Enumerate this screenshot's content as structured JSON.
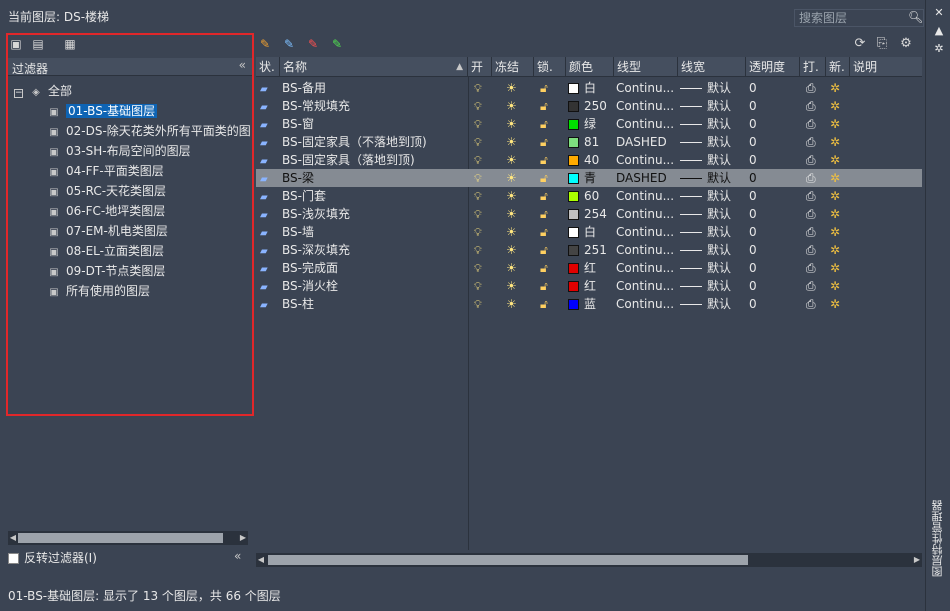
{
  "window": {
    "current_layer_label": "当前图层: DS-楼梯",
    "search_placeholder": "搜索图层",
    "side_title": "图层特性管理器"
  },
  "filters": {
    "header_label": "过滤器",
    "root_label": "全部",
    "items": [
      {
        "label": "01-BS-基础图层",
        "selected": true
      },
      {
        "label": "02-DS-除天花类外所有平面类的图"
      },
      {
        "label": "03-SH-布局空间的图层"
      },
      {
        "label": "04-FF-平面类图层"
      },
      {
        "label": "05-RC-天花类图层"
      },
      {
        "label": "06-FC-地坪类图层"
      },
      {
        "label": "07-EM-机电类图层"
      },
      {
        "label": "08-EL-立面类图层"
      },
      {
        "label": "09-DT-节点类图层"
      },
      {
        "label": "所有使用的图层"
      }
    ],
    "invert_label": "反转过滤器(I)"
  },
  "grid": {
    "headers": {
      "status": "状.",
      "name": "名称",
      "on": "开",
      "freeze": "冻结",
      "lock": "锁.",
      "color": "颜色",
      "linetype": "线型",
      "lineweight": "线宽",
      "transparency": "透明度",
      "plot": "打.",
      "newvp": "新.",
      "desc": "说明"
    },
    "rows": [
      {
        "name": "BS-备用",
        "color": "#ffffff",
        "color_name": "白",
        "linetype": "Continu...",
        "lineweight": "默认",
        "transparency": "0"
      },
      {
        "name": "BS-常规填充",
        "color": "#333333",
        "color_name": "250",
        "linetype": "Continu...",
        "lineweight": "默认",
        "transparency": "0"
      },
      {
        "name": "BS-窗",
        "color": "#00e000",
        "color_name": "绿",
        "linetype": "Continu...",
        "lineweight": "默认",
        "transparency": "0"
      },
      {
        "name": "BS-固定家具（不落地到顶)",
        "color": "#7fdf7f",
        "color_name": "81",
        "linetype": "DASHED",
        "lineweight": "默认",
        "transparency": "0"
      },
      {
        "name": "BS-固定家具（落地到顶)",
        "color": "#ffaa00",
        "color_name": "40",
        "linetype": "Continu...",
        "lineweight": "默认",
        "transparency": "0"
      },
      {
        "name": "BS-梁",
        "color": "#00ffff",
        "color_name": "青",
        "linetype": "DASHED",
        "lineweight": "默认",
        "transparency": "0",
        "selected": true
      },
      {
        "name": "BS-门套",
        "color": "#aaff00",
        "color_name": "60",
        "linetype": "Continu...",
        "lineweight": "默认",
        "transparency": "0"
      },
      {
        "name": "BS-浅灰填充",
        "color": "#c0c0c0",
        "color_name": "254",
        "linetype": "Continu...",
        "lineweight": "默认",
        "transparency": "0"
      },
      {
        "name": "BS-墙",
        "color": "#ffffff",
        "color_name": "白",
        "linetype": "Continu...",
        "lineweight": "默认",
        "transparency": "0"
      },
      {
        "name": "BS-深灰填充",
        "color": "#444444",
        "color_name": "251",
        "linetype": "Continu...",
        "lineweight": "默认",
        "transparency": "0"
      },
      {
        "name": "BS-完成面",
        "color": "#e00000",
        "color_name": "红",
        "linetype": "Continu...",
        "lineweight": "默认",
        "transparency": "0"
      },
      {
        "name": "BS-消火栓",
        "color": "#e00000",
        "color_name": "红",
        "linetype": "Continu...",
        "lineweight": "默认",
        "transparency": "0"
      },
      {
        "name": "BS-柱",
        "color": "#0000ff",
        "color_name": "蓝",
        "linetype": "Continu...",
        "lineweight": "默认",
        "transparency": "0"
      }
    ]
  },
  "status_bar": "01-BS-基础图层: 显示了 13 个图层，共 66 个图层",
  "colors": {
    "background": "#3b4453",
    "selection": "#0e64b4",
    "highlight_border": "#e1272a"
  }
}
